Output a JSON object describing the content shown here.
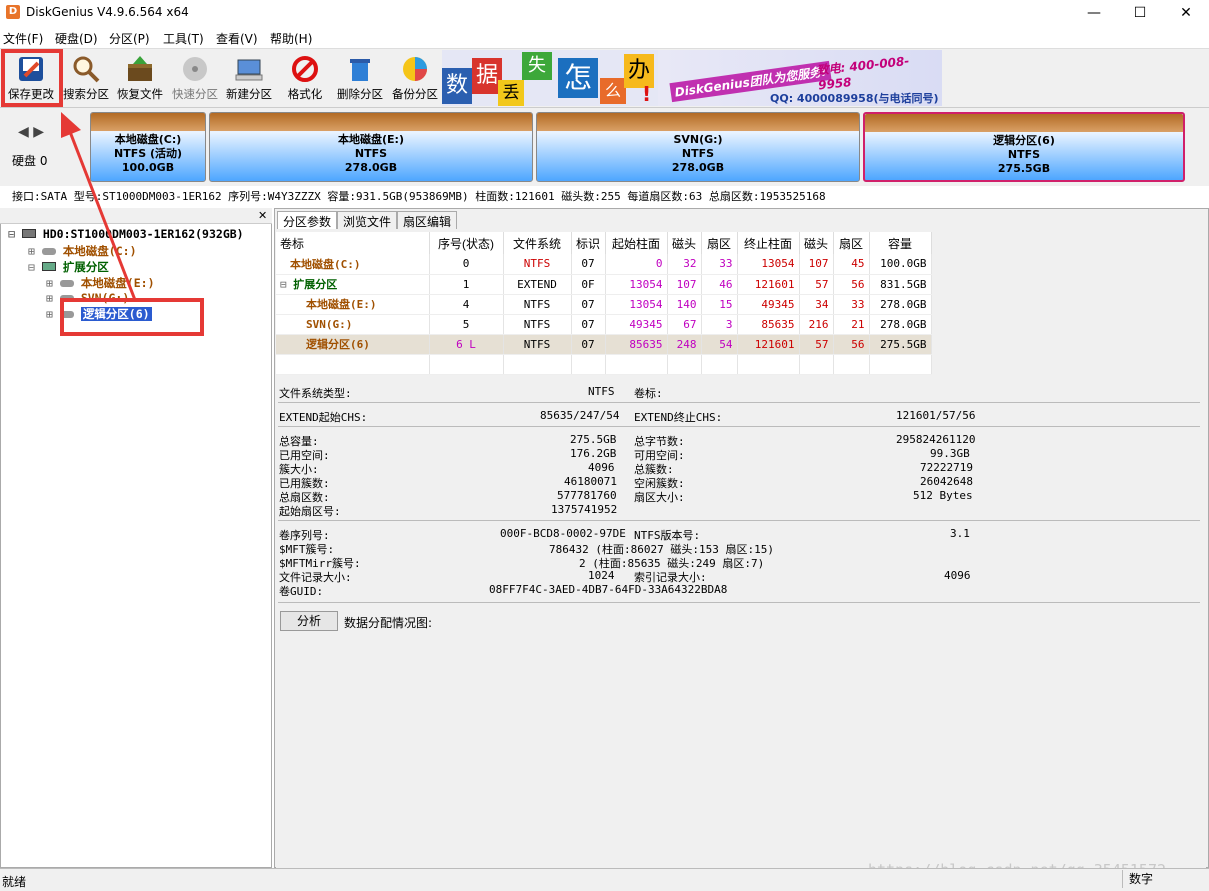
{
  "window": {
    "title": "DiskGenius V4.9.6.564 x64",
    "app_icon_letter": "D"
  },
  "menu": [
    "文件(F)",
    "硬盘(D)",
    "分区(P)",
    "工具(T)",
    "查看(V)",
    "帮助(H)"
  ],
  "toolbar": {
    "buttons": [
      "保存更改",
      "搜索分区",
      "恢复文件",
      "快速分区",
      "新建分区",
      "格式化",
      "删除分区",
      "备份分区"
    ]
  },
  "banner": {
    "chars": [
      "数",
      "据",
      "丢",
      "失",
      "怎",
      "么",
      "办",
      "!"
    ],
    "slogan": "DiskGenius团队为您服务!",
    "phone": "致电: 400-008-9958",
    "qq": "QQ: 4000089958(与电话同号)"
  },
  "diskmap": {
    "disk_label": "硬盘 0",
    "partitions": [
      {
        "name": "本地磁盘(C:)",
        "fs": "NTFS (活动)",
        "size": "100.0GB"
      },
      {
        "name": "本地磁盘(E:)",
        "fs": "NTFS",
        "size": "278.0GB"
      },
      {
        "name": "SVN(G:)",
        "fs": "NTFS",
        "size": "278.0GB"
      },
      {
        "name": "逻辑分区(6)",
        "fs": "NTFS",
        "size": "275.5GB"
      }
    ]
  },
  "infoline": "接口:SATA  型号:ST1000DM003-1ER162  序列号:W4Y3ZZZX  容量:931.5GB(953869MB)  柱面数:121601  磁头数:255  每道扇区数:63  总扇区数:1953525168",
  "tree": {
    "disk": "HD0:ST1000DM003-1ER162(932GB)",
    "items": [
      "本地磁盘(C:)",
      "扩展分区",
      "本地磁盘(E:)",
      "SVN(G:)",
      "逻辑分区(6)"
    ]
  },
  "tabs": [
    "分区参数",
    "浏览文件",
    "扇区编辑"
  ],
  "table": {
    "headers": [
      "卷标",
      "序号(状态)",
      "文件系统",
      "标识",
      "起始柱面",
      "磁头",
      "扇区",
      "终止柱面",
      "磁头",
      "扇区",
      "容量"
    ],
    "rows": [
      [
        "本地磁盘(C:)",
        "0",
        "NTFS",
        "07",
        "0",
        "32",
        "33",
        "13054",
        "107",
        "45",
        "100.0GB"
      ],
      [
        "扩展分区",
        "1",
        "EXTEND",
        "0F",
        "13054",
        "107",
        "46",
        "121601",
        "57",
        "56",
        "831.5GB"
      ],
      [
        "本地磁盘(E:)",
        "4",
        "NTFS",
        "07",
        "13054",
        "140",
        "15",
        "49345",
        "34",
        "33",
        "278.0GB"
      ],
      [
        "SVN(G:)",
        "5",
        "NTFS",
        "07",
        "49345",
        "67",
        "3",
        "85635",
        "216",
        "21",
        "278.0GB"
      ],
      [
        "逻辑分区(6)",
        "6 L",
        "NTFS",
        "07",
        "85635",
        "248",
        "54",
        "121601",
        "57",
        "56",
        "275.5GB"
      ]
    ]
  },
  "details": {
    "fs_type_label": "文件系统类型:",
    "fs_type": "NTFS",
    "vol_label": "卷标:",
    "ext_start_label": "EXTEND起始CHS:",
    "ext_start": "85635/247/54",
    "ext_end_label": "EXTEND终止CHS:",
    "ext_end": "121601/57/56",
    "left1": [
      [
        "总容量:",
        "275.5GB"
      ],
      [
        "已用空间:",
        "176.2GB"
      ],
      [
        "簇大小:",
        "4096"
      ],
      [
        "已用簇数:",
        "46180071"
      ],
      [
        "总扇区数:",
        "577781760"
      ],
      [
        "起始扇区号:",
        "1375741952"
      ]
    ],
    "right1": [
      [
        "总字节数:",
        "295824261120"
      ],
      [
        "可用空间:",
        "99.3GB"
      ],
      [
        "总簇数:",
        "72222719"
      ],
      [
        "空闲簇数:",
        "26042648"
      ],
      [
        "扇区大小:",
        "512 Bytes"
      ]
    ],
    "left2": [
      [
        "卷序列号:",
        "000F-BCD8-0002-97DE"
      ],
      [
        "$MFT簇号:",
        "786432 (柱面:86027 磁头:153 扇区:15)"
      ],
      [
        "$MFTMirr簇号:",
        "2 (柱面:85635 磁头:249 扇区:7)"
      ],
      [
        "文件记录大小:",
        "1024"
      ],
      [
        "卷GUID:",
        "08FF7F4C-3AED-4DB7-64FD-33A64322BDA8"
      ]
    ],
    "right2": [
      [
        "NTFS版本号:",
        "3.1"
      ],
      [
        "索引记录大小:",
        "4096"
      ]
    ],
    "analyze_button": "分析",
    "alloc_label": "数据分配情况图:"
  },
  "status": {
    "left": "就绪",
    "right": "数字"
  },
  "watermark": "https://blog.csdn.net/qq_35451572"
}
